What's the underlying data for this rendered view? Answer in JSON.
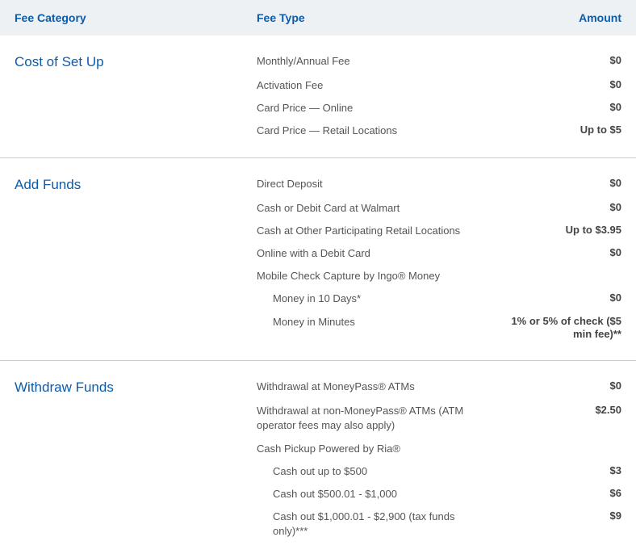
{
  "headers": {
    "category": "Fee Category",
    "type": "Fee Type",
    "amount": "Amount"
  },
  "sections": [
    {
      "category": "Cost of Set Up",
      "rows": [
        {
          "type": "Monthly/Annual Fee",
          "amount": "$0",
          "indent": false
        },
        {
          "type": "Activation Fee",
          "amount": "$0",
          "indent": false
        },
        {
          "type": "Card Price — Online",
          "amount": "$0",
          "indent": false
        },
        {
          "type": "Card Price — Retail Locations",
          "amount": "Up to $5",
          "indent": false
        }
      ]
    },
    {
      "category": "Add Funds",
      "rows": [
        {
          "type": "Direct Deposit",
          "amount": "$0",
          "indent": false
        },
        {
          "type": "Cash or Debit Card at Walmart",
          "amount": "$0",
          "indent": false
        },
        {
          "type": "Cash at Other Participating Retail Locations",
          "amount": "Up to $3.95",
          "indent": false
        },
        {
          "type": "Online with a Debit Card",
          "amount": "$0",
          "indent": false
        },
        {
          "type": "Mobile Check Capture by Ingo® Money",
          "amount": "",
          "indent": false
        },
        {
          "type": "Money in 10 Days*",
          "amount": "$0",
          "indent": true
        },
        {
          "type": "Money in Minutes",
          "amount": "1% or 5% of check ($5 min fee)**",
          "indent": true
        }
      ]
    },
    {
      "category": "Withdraw Funds",
      "rows": [
        {
          "type": "Withdrawal at MoneyPass® ATMs",
          "amount": "$0",
          "indent": false
        },
        {
          "type": "Withdrawal at non-MoneyPass® ATMs (ATM operator fees may also apply)",
          "amount": "$2.50",
          "indent": false
        },
        {
          "type": "Cash Pickup Powered by Ria®",
          "amount": "",
          "indent": false
        },
        {
          "type": "Cash out up to $500",
          "amount": "$3",
          "indent": true
        },
        {
          "type": "Cash out $500.01 - $1,000",
          "amount": "$6",
          "indent": true
        },
        {
          "type": "Cash out $1,000.01 - $2,900 (tax funds only)***",
          "amount": "$9",
          "indent": true
        }
      ]
    }
  ]
}
